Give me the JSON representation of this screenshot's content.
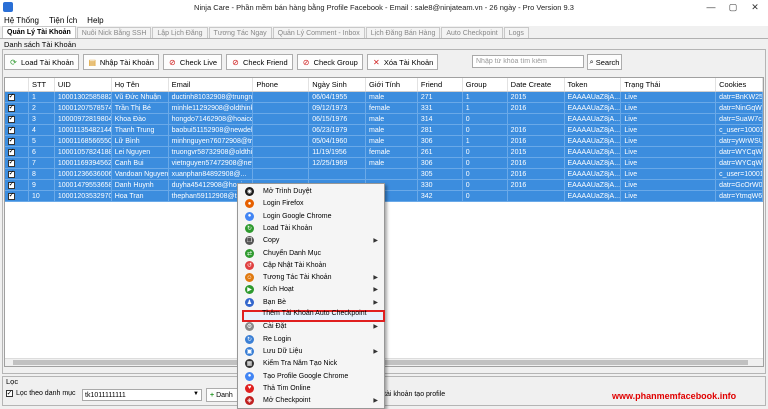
{
  "window": {
    "title": "Ninja Care - Phần mềm bán hàng bằng Profile Facebook - Email : sale8@ninjateam.vn - 26 ngày - Pro Version 9.3",
    "controls": [
      "—",
      "▢",
      "✕"
    ]
  },
  "menu": [
    "Hệ Thống",
    "Tiện Ích",
    "Help"
  ],
  "tabs": [
    {
      "label": "Quản Lý Tài Khoản",
      "active": true
    },
    {
      "label": "Nuôi Nick Bằng SSH",
      "active": false
    },
    {
      "label": "Lập Lịch Đăng",
      "active": false
    },
    {
      "label": "Tương Tác Ngay",
      "active": false
    },
    {
      "label": "Quản Lý Comment - Inbox",
      "active": false
    },
    {
      "label": "Lịch Đăng Bán Hàng",
      "active": false
    },
    {
      "label": "Auto Checkpoint",
      "active": false
    },
    {
      "label": "Logs",
      "active": false
    }
  ],
  "section_label": "Danh sách Tài Khoản",
  "toolbar": {
    "load": "Load Tài Khoản",
    "import": "Nhập Tài Khoản",
    "check_live": "Check Live",
    "check_friend": "Check Friend",
    "check_group": "Check Group",
    "delete": "Xóa Tài Khoản",
    "search_placeholder": "Nhập từ khóa tìm kiếm",
    "search": "Search"
  },
  "columns": [
    "",
    "STT",
    "UID",
    "Họ Tên",
    "Email",
    "Phone",
    "Ngày Sinh",
    "Giới Tính",
    "Friend",
    "Group",
    "Date Create",
    "Token",
    "Trạng Thái",
    "Cookies"
  ],
  "rows": [
    [
      "✓",
      "1",
      "100013025858823",
      "Vũ Đức Nhuận",
      "ductinh81032908@trungng...",
      "",
      "06/04/1955",
      "male",
      "271",
      "1",
      "2015",
      "EAAAAUaZ8jA...",
      "Live",
      "datr=BnKW25Ff..."
    ],
    [
      "✓",
      "2",
      "100012075785744",
      "Trần Thị Bé",
      "minhle11292908@oldthink.ml",
      "",
      "09/12/1973",
      "female",
      "331",
      "1",
      "2016",
      "EAAAAUaZ8jA...",
      "Live",
      "datr=NinGqW_9..."
    ],
    [
      "✓",
      "3",
      "100009728198047",
      "Khoa Đào",
      "hongdo71462908@hoaicou...",
      "",
      "06/15/1976",
      "male",
      "314",
      "0",
      "",
      "EAAAAUaZ8jA...",
      "Live",
      "datr=SuaW7ce7..."
    ],
    [
      "✓",
      "4",
      "100011354821440",
      "Thanh Trung",
      "baobui51152908@newdell.ml",
      "",
      "06/23/1979",
      "male",
      "281",
      "0",
      "2016",
      "EAAAAUaZ8jA...",
      "Live",
      "c_user=100013..."
    ],
    [
      "✓",
      "5",
      "100011685665500",
      "Lữ Bình",
      "minhnguyen76072908@trun...",
      "",
      "05/04/1960",
      "male",
      "306",
      "1",
      "2016",
      "EAAAAUaZ8jA...",
      "Live",
      "datr=yWrWSU1vL..."
    ],
    [
      "✓",
      "6",
      "100010578241880",
      "Lei Nguyen",
      "truongvr58732908@oldthin...",
      "",
      "11/19/1956",
      "female",
      "261",
      "0",
      "2015",
      "EAAAAUaZ8jA...",
      "Live",
      "datr=WYCqWBU..."
    ],
    [
      "✓",
      "7",
      "100011693945624",
      "Canh Bui",
      "vietnguyen57472908@new...",
      "",
      "12/25/1969",
      "male",
      "306",
      "0",
      "2016",
      "EAAAAUaZ8jA...",
      "Live",
      "datr=WYCqWBU..."
    ],
    [
      "✓",
      "8",
      "100012366360062",
      "Vandoan Nguyen",
      "xuanphan84892908@...",
      "",
      "",
      "",
      "305",
      "0",
      "2016",
      "EAAAAUaZ8jA...",
      "Live",
      "c_user=1000123..."
    ],
    [
      "✓",
      "9",
      "100014795536589",
      "Danh Huynh",
      "duyha45412908@hoaicou...",
      "",
      "",
      "",
      "330",
      "0",
      "2016",
      "EAAAAUaZ8jA...",
      "Live",
      "datr=GcOrW0T2..."
    ],
    [
      "✓",
      "10",
      "100012035329708",
      "Hoa Tran",
      "thephan59112908@trunga...",
      "",
      "",
      "",
      "342",
      "0",
      "",
      "EAAAAUaZ8jA...",
      "Live",
      "datr=YtmqW6UQ..."
    ]
  ],
  "filter": {
    "title": "Lọc",
    "checkbox_label": "Lọc theo danh mục",
    "select_value": "tk1011111111",
    "add_button": "Danh",
    "note": "tài khoản tạo profile"
  },
  "watermark": "www.phanmemfacebook.info",
  "context_menu": [
    {
      "label": "Mở Trình Duyệt",
      "icon": "globe-icon",
      "color": "#1c1c1c",
      "sub": false
    },
    {
      "label": "Login Firefox",
      "icon": "firefox-icon",
      "color": "#e66000",
      "sub": false
    },
    {
      "label": "Login Google Chrome",
      "icon": "chrome-icon",
      "color": "#4285f4",
      "sub": false
    },
    {
      "label": "Load Tài Khoản",
      "icon": "load-icon",
      "color": "#2e9a2e",
      "sub": false
    },
    {
      "label": "Copy",
      "icon": "copy-icon",
      "color": "#555555",
      "sub": true
    },
    {
      "label": "Chuyển Danh Mục",
      "icon": "move-icon",
      "color": "#2e9a2e",
      "sub": false
    },
    {
      "label": "Cập Nhật Tài Khoản",
      "icon": "update-icon",
      "color": "#e04040",
      "sub": false
    },
    {
      "label": "Tương Tác Tài Khoản",
      "icon": "interact-icon",
      "color": "#e07a10",
      "sub": true
    },
    {
      "label": "Kích Hoạt",
      "icon": "activate-icon",
      "color": "#2e9a2e",
      "sub": true
    },
    {
      "label": "Bạn Bè",
      "icon": "friends-icon",
      "color": "#3366cc",
      "sub": true
    },
    {
      "label": "Thêm Tài Khoản Auto Checkpoint",
      "icon": "",
      "color": "",
      "sub": false
    },
    {
      "label": "Cài Đặt",
      "icon": "settings-icon",
      "color": "#888888",
      "sub": true
    },
    {
      "label": "Re Login",
      "icon": "relogin-icon",
      "color": "#3a7fd5",
      "sub": false
    },
    {
      "label": "Lưu Dữ Liệu",
      "icon": "save-icon",
      "color": "#3a7fd5",
      "sub": true
    },
    {
      "label": "Kiểm Tra Năm Tạo Nick",
      "icon": "calendar-icon",
      "color": "#333333",
      "sub": false
    },
    {
      "label": "Tạo Profile Google Chrome",
      "icon": "chrome-icon",
      "color": "#4285f4",
      "sub": false
    },
    {
      "label": "Thả Tim Online",
      "icon": "heart-icon",
      "color": "#e02020",
      "sub": false
    },
    {
      "label": "Mở Checkpoint",
      "icon": "shield-icon",
      "color": "#c02020",
      "sub": true
    }
  ]
}
